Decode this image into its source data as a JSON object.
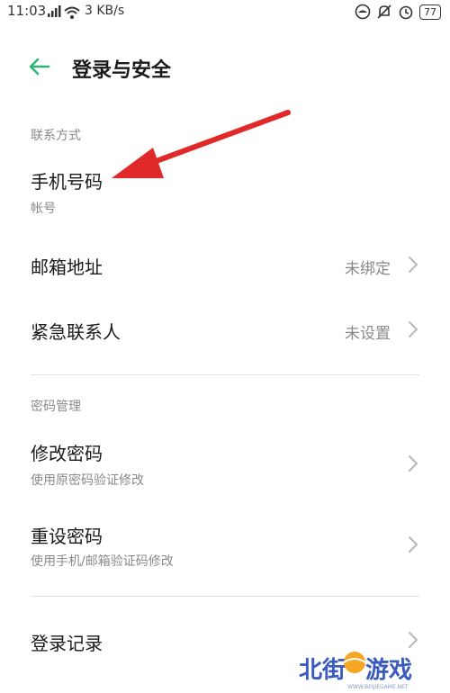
{
  "status_bar": {
    "time": "11:03",
    "network_speed": "3 KB/s",
    "battery": "77",
    "icons": [
      "signal-icon",
      "wifi-icon",
      "cast-icon",
      "mute-bell-icon",
      "alarm-icon",
      "battery-icon"
    ]
  },
  "header": {
    "back_icon": "back-arrow-icon",
    "title": "登录与安全"
  },
  "sections": {
    "contact": {
      "header": "联系方式",
      "phone": {
        "title": "手机号码",
        "subtitle": "帐号"
      },
      "email": {
        "title": "邮箱地址",
        "value": "未绑定"
      },
      "emergency": {
        "title": "紧急联系人",
        "value": "未设置"
      }
    },
    "password": {
      "header": "密码管理",
      "change": {
        "title": "修改密码",
        "subtitle": "使用原密码验证修改"
      },
      "reset": {
        "title": "重设密码",
        "subtitle": "使用手机/邮箱验证码修改"
      }
    },
    "login_history": {
      "title": "登录记录"
    }
  },
  "colors": {
    "accent": "#2bb673",
    "annotation_arrow": "#e02a2a",
    "secondary_text": "#8a8a8a",
    "watermark": "#3a5bbf"
  },
  "watermark": {
    "text_1": "北街",
    "text_2": "游戏",
    "url": "WWW.BEIJIEGAME.NET"
  }
}
